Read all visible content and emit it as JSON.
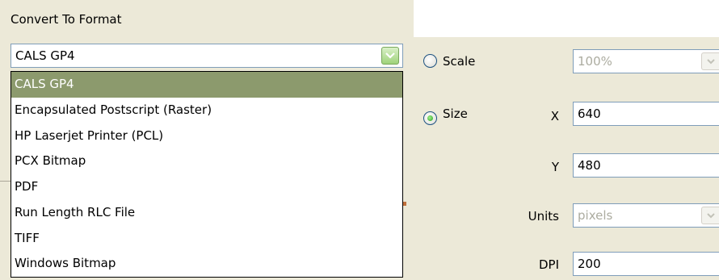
{
  "convert": {
    "section_label": "Convert To Format",
    "selected_value": "CALS GP4",
    "options": [
      "CALS GP4",
      "Encapsulated Postscript (Raster)",
      "HP Laserjet Printer (PCL)",
      "PCX Bitmap",
      "PDF",
      "Run Length RLC File",
      "TIFF",
      "Windows Bitmap"
    ],
    "highlighted_index": 0
  },
  "size_panel": {
    "scale": {
      "label": "Scale",
      "checked": false,
      "value": "100%",
      "enabled": false
    },
    "size": {
      "label": "Size",
      "checked": true
    },
    "x": {
      "label": "X",
      "value": "640"
    },
    "y": {
      "label": "Y",
      "value": "480"
    },
    "units": {
      "label": "Units",
      "value": "pixels",
      "enabled": false
    },
    "dpi": {
      "label": "DPI",
      "value": "200"
    }
  },
  "icons": {
    "combo_arrow": "chevron-down-icon",
    "scale_arrow": "chevron-down-icon",
    "units_arrow": "chevron-down-icon"
  },
  "colors": {
    "panel_bg": "#ece9d8",
    "selection_bg": "#8c9a6d",
    "field_border": "#7f9db9",
    "radio_dot": "#21a121"
  }
}
